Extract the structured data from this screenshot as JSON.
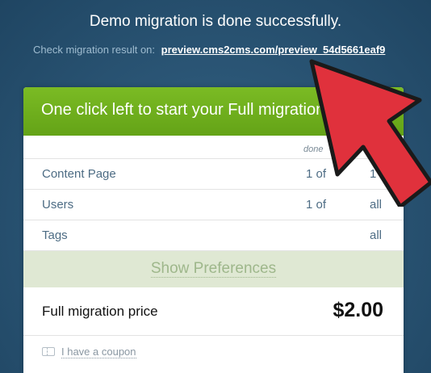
{
  "headline": "Demo migration is done successfully.",
  "check_line": {
    "prefix": "Check migration result on:",
    "link": "preview.cms2cms.com/preview_54d5661eaf9"
  },
  "panel": {
    "header": "One click left to start your Full migration",
    "column_done": "done",
    "rows": [
      {
        "label": "Content Page",
        "count": "1 of",
        "total": "1"
      },
      {
        "label": "Users",
        "count": "1 of",
        "total": "all"
      },
      {
        "label": "Tags",
        "count": "",
        "total": "all"
      }
    ],
    "show_preferences": "Show Preferences",
    "price_label": "Full migration price",
    "price_value": "$2.00",
    "coupon": "I have a coupon"
  },
  "colors": {
    "header_green": "#6fae1e",
    "arrow_red": "#e0313c",
    "background": "#2b5676"
  },
  "icons": [
    "coupon-ticket-icon",
    "pointer-arrow-icon"
  ]
}
